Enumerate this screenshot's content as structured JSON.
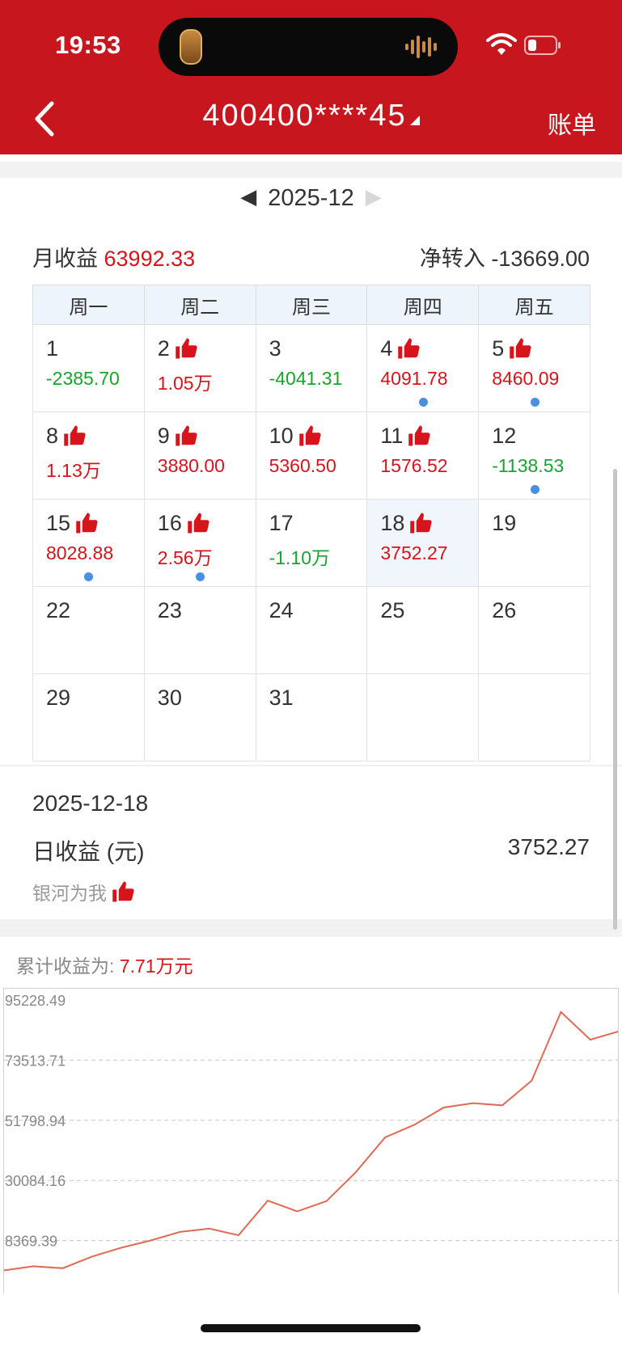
{
  "status_bar": {
    "time": "19:53"
  },
  "header": {
    "account": "400400****45",
    "bill_label": "账单"
  },
  "month_nav": {
    "current": "2025-12"
  },
  "summary": {
    "month_income_label": "月收益",
    "month_income_value": "63992.33",
    "net_transfer_label": "净转入",
    "net_transfer_value": "-13669.00"
  },
  "calendar": {
    "weekdays": [
      "周一",
      "周二",
      "周三",
      "周四",
      "周五"
    ],
    "weeks": [
      [
        {
          "day": "1",
          "value": "-2385.70",
          "sign": "neg",
          "thumb": false,
          "dot": false
        },
        {
          "day": "2",
          "value": "1.05万",
          "sign": "pos",
          "thumb": true,
          "dot": false
        },
        {
          "day": "3",
          "value": "-4041.31",
          "sign": "neg",
          "thumb": false,
          "dot": false
        },
        {
          "day": "4",
          "value": "4091.78",
          "sign": "pos",
          "thumb": true,
          "dot": true
        },
        {
          "day": "5",
          "value": "8460.09",
          "sign": "pos",
          "thumb": true,
          "dot": true
        }
      ],
      [
        {
          "day": "8",
          "value": "1.13万",
          "sign": "pos",
          "thumb": true,
          "dot": false
        },
        {
          "day": "9",
          "value": "3880.00",
          "sign": "pos",
          "thumb": true,
          "dot": false
        },
        {
          "day": "10",
          "value": "5360.50",
          "sign": "pos",
          "thumb": true,
          "dot": false
        },
        {
          "day": "11",
          "value": "1576.52",
          "sign": "pos",
          "thumb": true,
          "dot": false
        },
        {
          "day": "12",
          "value": "-1138.53",
          "sign": "neg",
          "thumb": false,
          "dot": true
        }
      ],
      [
        {
          "day": "15",
          "value": "8028.88",
          "sign": "pos",
          "thumb": true,
          "dot": true
        },
        {
          "day": "16",
          "value": "2.56万",
          "sign": "pos",
          "thumb": true,
          "dot": true
        },
        {
          "day": "17",
          "value": "-1.10万",
          "sign": "neg",
          "thumb": false,
          "dot": false
        },
        {
          "day": "18",
          "value": "3752.27",
          "sign": "pos",
          "thumb": true,
          "dot": false,
          "selected": true
        },
        {
          "day": "19",
          "value": "",
          "sign": "",
          "thumb": false,
          "dot": false
        }
      ],
      [
        {
          "day": "22",
          "value": "",
          "sign": "",
          "thumb": false,
          "dot": false
        },
        {
          "day": "23",
          "value": "",
          "sign": "",
          "thumb": false,
          "dot": false
        },
        {
          "day": "24",
          "value": "",
          "sign": "",
          "thumb": false,
          "dot": false
        },
        {
          "day": "25",
          "value": "",
          "sign": "",
          "thumb": false,
          "dot": false
        },
        {
          "day": "26",
          "value": "",
          "sign": "",
          "thumb": false,
          "dot": false
        }
      ],
      [
        {
          "day": "29",
          "value": "",
          "sign": "",
          "thumb": false,
          "dot": false
        },
        {
          "day": "30",
          "value": "",
          "sign": "",
          "thumb": false,
          "dot": false
        },
        {
          "day": "31",
          "value": "",
          "sign": "",
          "thumb": false,
          "dot": false
        },
        {
          "day": "",
          "value": "",
          "sign": "",
          "thumb": false,
          "dot": false
        },
        {
          "day": "",
          "value": "",
          "sign": "",
          "thumb": false,
          "dot": false
        }
      ]
    ]
  },
  "detail": {
    "date": "2025-12-18",
    "income_label": "日收益 (元)",
    "income_value": "3752.27",
    "tag": "银河为我"
  },
  "cumulative": {
    "label": "累计收益为:",
    "value": "7.71万元"
  },
  "colors": {
    "brand_red": "#c8161e",
    "positive": "#d7141c",
    "negative": "#16a52d",
    "dot_blue": "#4a8fe2",
    "line": "#e06a55"
  },
  "chart_data": {
    "type": "line",
    "title": "",
    "xlabel": "",
    "ylabel": "",
    "yticks": [
      95228.49,
      73513.71,
      51798.94,
      30084.16,
      8369.39
    ],
    "ylim": [
      -13345.38,
      95228.49
    ],
    "grid": true,
    "series": [
      {
        "values": [
          -2400,
          -900,
          -1600,
          2600,
          5800,
          8400,
          11500,
          12700,
          10300,
          22800,
          18900,
          22600,
          33100,
          45600,
          50200,
          56400,
          58000,
          57200,
          66100,
          90900,
          80900,
          84000
        ]
      }
    ]
  }
}
